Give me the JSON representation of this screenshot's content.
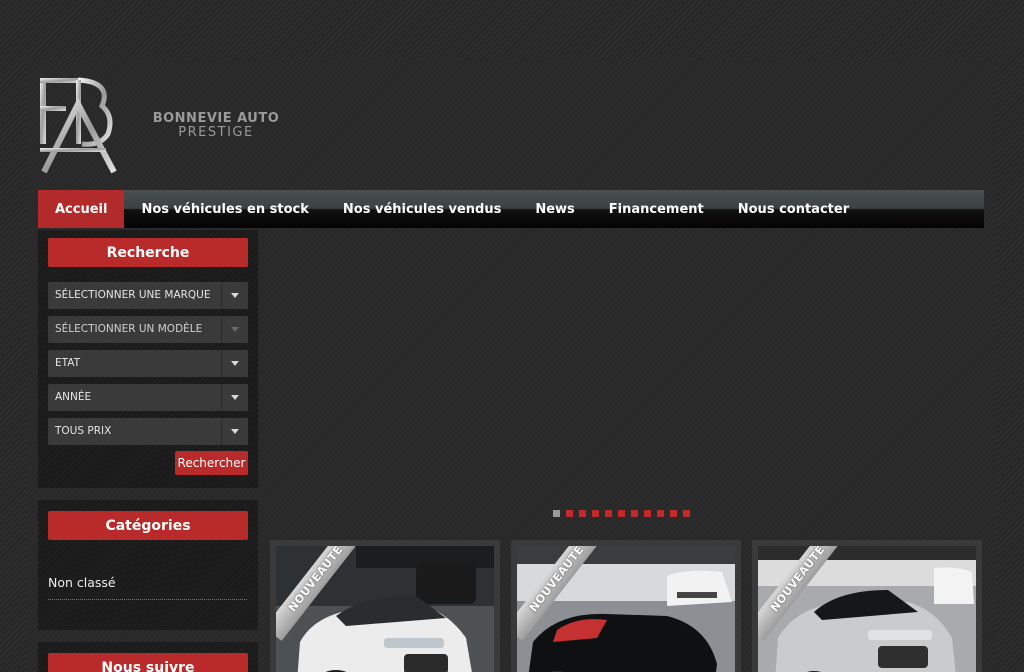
{
  "brand": {
    "name": "BONNEVIE AUTO",
    "tagline": "PRESTIGE"
  },
  "nav": {
    "items": [
      {
        "label": "Accueil",
        "active": true
      },
      {
        "label": "Nos véhicules en stock",
        "active": false
      },
      {
        "label": "Nos véhicules vendus",
        "active": false
      },
      {
        "label": "News",
        "active": false
      },
      {
        "label": "Financement",
        "active": false
      },
      {
        "label": "Nous contacter",
        "active": false
      }
    ]
  },
  "search": {
    "title": "Recherche",
    "selects": [
      {
        "value": "SÉLECTIONNER UNE MARQUE",
        "disabled": false
      },
      {
        "value": "SÉLECTIONNER UN MODÈLE",
        "disabled": true
      },
      {
        "value": "ETAT",
        "disabled": false
      },
      {
        "value": "ANNÉE",
        "disabled": false
      },
      {
        "value": "TOUS PRIX",
        "disabled": false
      }
    ],
    "button_label": "Rechercher"
  },
  "categories": {
    "title": "Catégories",
    "items": [
      "Non classé"
    ]
  },
  "follow": {
    "title": "Nous suivre"
  },
  "slider": {
    "slide_count": 11,
    "active_index": 0
  },
  "vehicles": [
    {
      "badge": "NOUVEAUTÉ",
      "color": "white"
    },
    {
      "badge": "NOUVEAUTÉ",
      "color": "black"
    },
    {
      "badge": "NOUVEAUTÉ",
      "color": "silver"
    }
  ],
  "colors": {
    "accent": "#b92b2b",
    "background": "#2b2b2b"
  }
}
